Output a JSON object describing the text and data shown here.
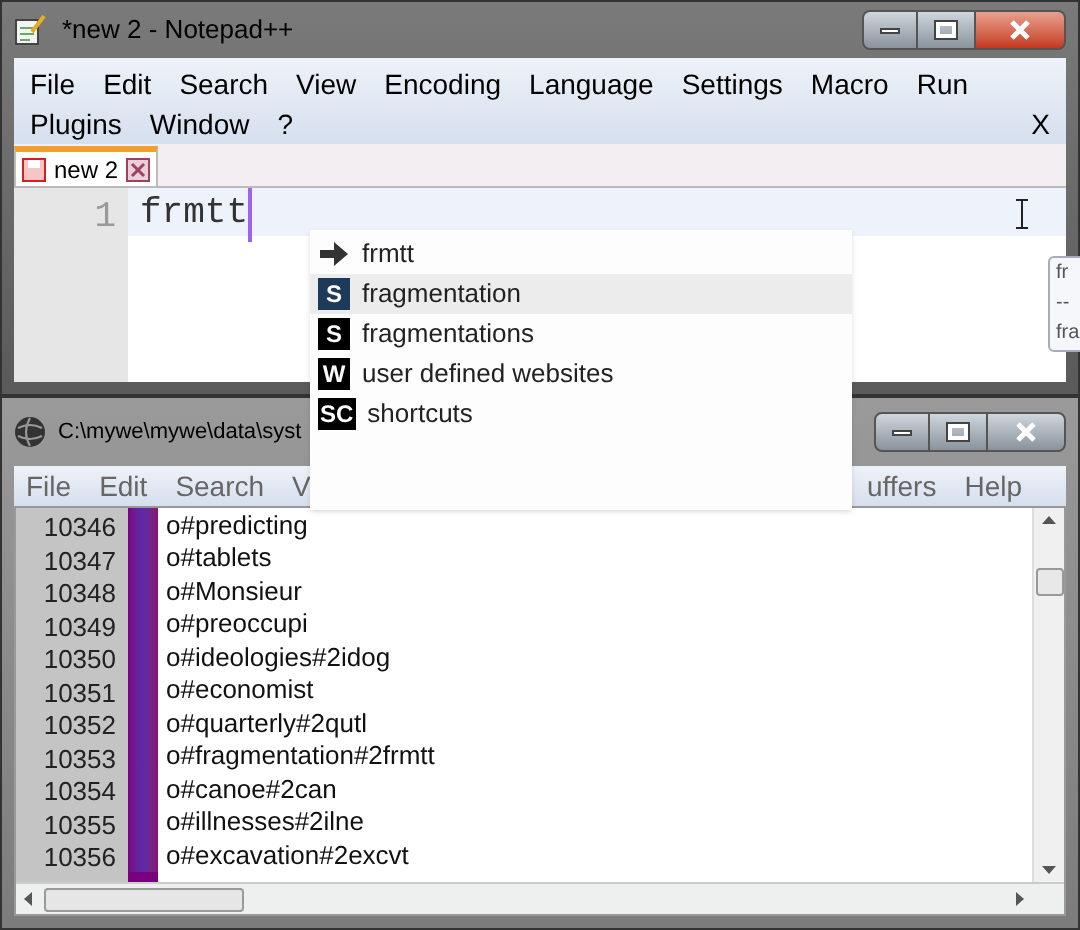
{
  "main_window": {
    "title": "*new  2 - Notepad++",
    "menu_line_1": [
      "File",
      "Edit",
      "Search",
      "View",
      "Encoding",
      "Language",
      "Settings",
      "Macro",
      "Run"
    ],
    "menu_line_2": [
      "Plugins",
      "Window",
      "?"
    ],
    "menu_close": "X",
    "tabs": [
      {
        "label": "new  2",
        "selected": true
      }
    ],
    "editor": {
      "line_number": "1",
      "text": "frmtt"
    },
    "tooltip_lines": [
      "fr",
      "--",
      "fra"
    ]
  },
  "autocomplete": [
    {
      "kind": "arrow",
      "label": "frmtt",
      "selected": false
    },
    {
      "kind": "badge",
      "badge": "S",
      "label": "fragmentation",
      "selected": true
    },
    {
      "kind": "badge",
      "badge": "S",
      "label": "fragmentations",
      "selected": false
    },
    {
      "kind": "badge",
      "badge": "W",
      "label": "user defined websites",
      "selected": false
    },
    {
      "kind": "badge",
      "badge": "SC",
      "label": "shortcuts",
      "selected": false
    }
  ],
  "second_window": {
    "title": "C:\\mywe\\mywe\\data\\syst",
    "menu_left": [
      "File",
      "Edit",
      "Search",
      "V"
    ],
    "menu_right": [
      "uffers",
      "Help"
    ],
    "rows": [
      {
        "number": "10346",
        "text": "o#predicting"
      },
      {
        "number": "10347",
        "text": "o#tablets"
      },
      {
        "number": "10348",
        "text": "o#Monsieur"
      },
      {
        "number": "10349",
        "text": "o#preoccupi"
      },
      {
        "number": "10350",
        "text": "o#ideologies#2idog"
      },
      {
        "number": "10351",
        "text": "o#economist"
      },
      {
        "number": "10352",
        "text": "o#quarterly#2qutl"
      },
      {
        "number": "10353",
        "text": "o#fragmentation#2frmtt"
      },
      {
        "number": "10354",
        "text": "o#canoe#2can"
      },
      {
        "number": "10355",
        "text": "o#illnesses#2ilne"
      },
      {
        "number": "10356",
        "text": "o#excavation#2excvt"
      }
    ]
  }
}
